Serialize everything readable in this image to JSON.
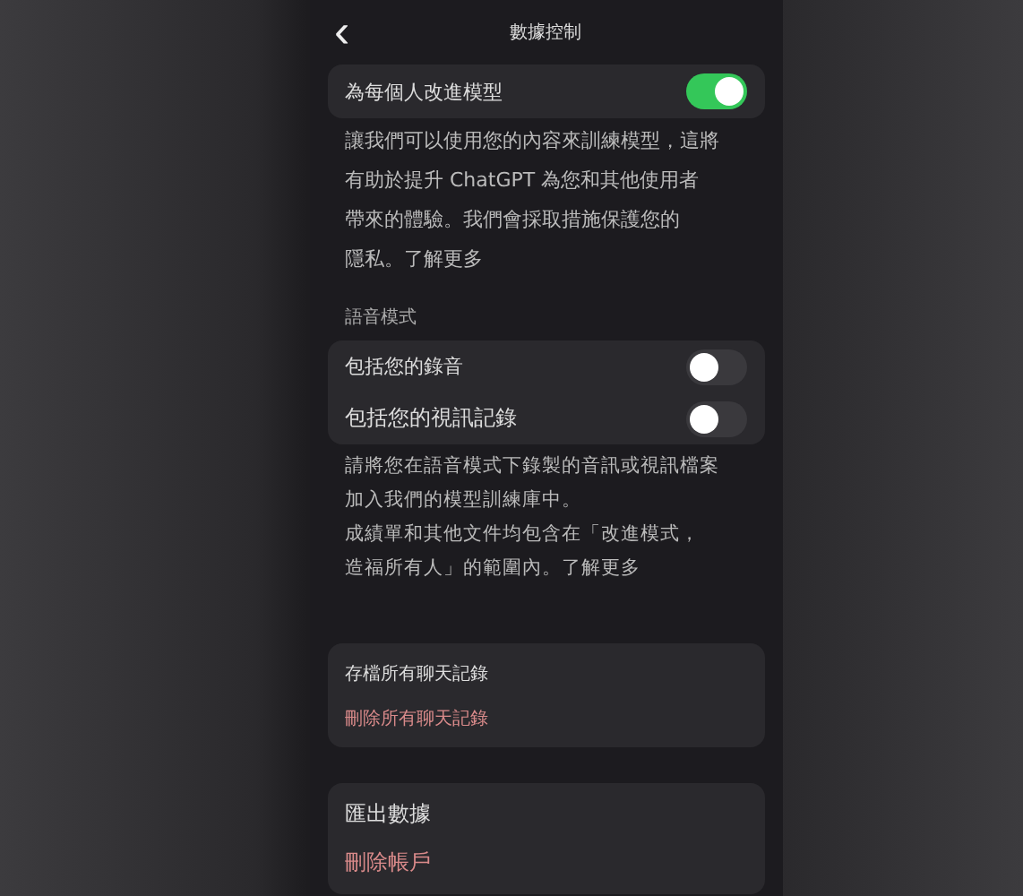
{
  "header": {
    "back_icon": "‹",
    "title": "數據控制"
  },
  "improve": {
    "label": "為每個人改進模型",
    "on": true
  },
  "improve_note": [
    "讓我們可以使用您的內容來訓練模型，這將",
    "有助於提升 ChatGPT 為您和其他使用者",
    "帶來的體驗。我們會採取措施保護您的",
    "隱私。了解更多"
  ],
  "voice_section": "語音模式",
  "voice_toggles": [
    {
      "label": "包括您的錄音",
      "on": false
    },
    {
      "label": "包括您的視訊記錄",
      "on": false
    }
  ],
  "voice_note": [
    "請將您在語音模式下錄製的音訊或視訊檔案",
    "加入我們的模型訓練庫中。",
    "成績單和其他文件均包含在「改進模式，",
    "造福所有人」的範圍內。了解更多"
  ],
  "cards": [
    [
      {
        "label": "存檔所有聊天記錄",
        "kind": "normal"
      },
      {
        "label": "刪除所有聊天記錄",
        "kind": "danger"
      }
    ],
    [
      {
        "label": "匯出數據",
        "kind": "normal"
      },
      {
        "label": "刪除帳戶",
        "kind": "danger"
      }
    ]
  ]
}
